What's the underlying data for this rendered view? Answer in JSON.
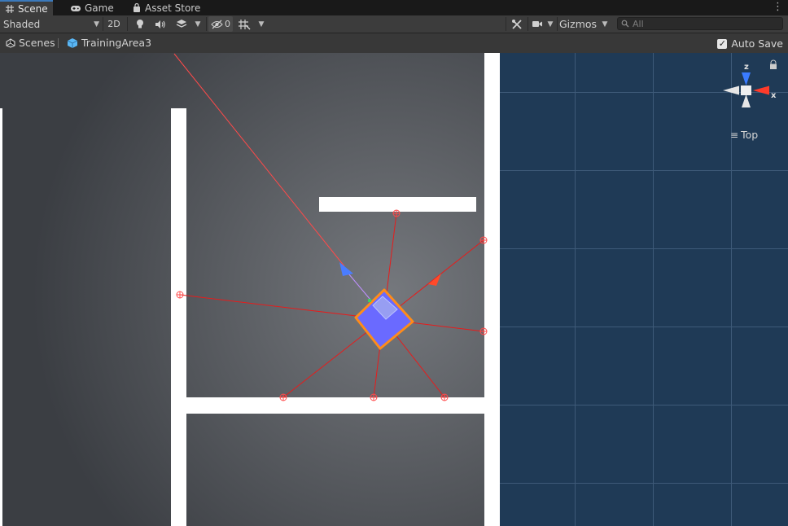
{
  "tabs": [
    {
      "label": "Scene",
      "icon": "grid-icon",
      "active": true
    },
    {
      "label": "Game",
      "icon": "gamepad-icon",
      "active": false
    },
    {
      "label": "Asset Store",
      "icon": "bag-icon",
      "active": false
    }
  ],
  "toolbar": {
    "draw_mode": "Shaded",
    "mode_2d": "2D",
    "hidden_count": "0",
    "gizmos_label": "Gizmos",
    "search_placeholder": "All"
  },
  "breadcrumb": {
    "root": "Scenes",
    "current": "TrainingArea3"
  },
  "autosave": {
    "label": "Auto Save",
    "checked": true
  },
  "orientation_gizmo": {
    "view_label": "Top",
    "axis_z": "z",
    "axis_x": "x"
  },
  "colors": {
    "grid_background": "#1f3a56",
    "scene_center": "#6d7075",
    "walls": "#ffffff",
    "agent_fill": "#6a6aff",
    "agent_outline": "#ff8c1a",
    "rays": "#e81b1b",
    "tab_accent": "#3a79bb"
  }
}
